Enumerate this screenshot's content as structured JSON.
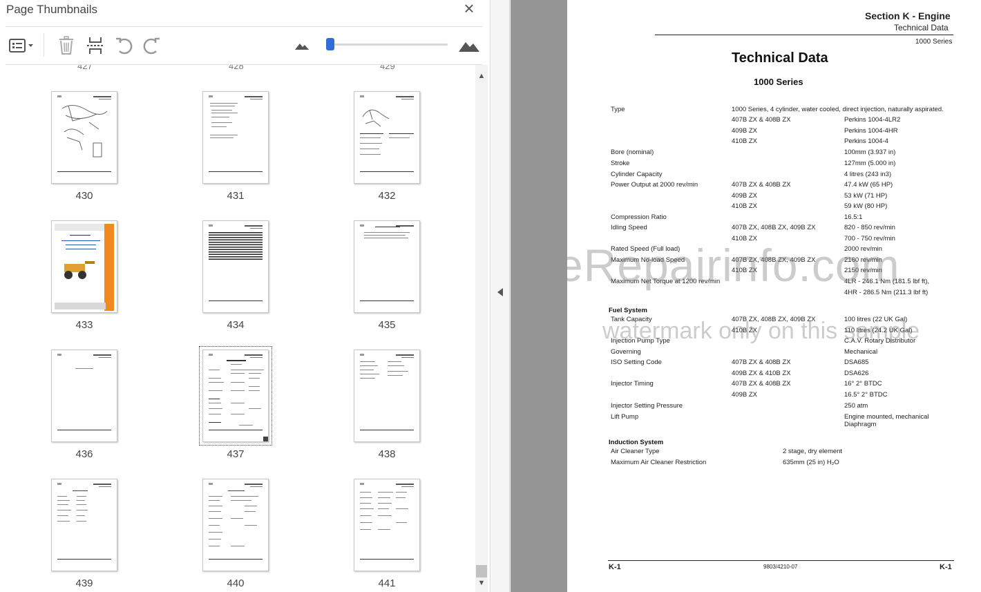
{
  "panel": {
    "title": "Page Thumbnails",
    "close_icon": "×"
  },
  "toolbar": {
    "options_icon": "options-list-icon",
    "delete_icon": "trash-icon",
    "insert_icon": "insert-pages-icon",
    "rotate_left_icon": "rotate-ccw-icon",
    "rotate_right_icon": "rotate-cw-icon",
    "zoom_out_icon": "mountain-small-icon",
    "zoom_in_icon": "mountain-large-icon",
    "zoom_level": 0.0,
    "accent": "#2d6fd6"
  },
  "thumbnails": {
    "partial_labels": [
      "427",
      "428",
      "429"
    ],
    "selected": "437",
    "pages": [
      {
        "label": "430"
      },
      {
        "label": "431"
      },
      {
        "label": "432"
      },
      {
        "label": "433"
      },
      {
        "label": "434"
      },
      {
        "label": "435"
      },
      {
        "label": "436"
      },
      {
        "label": "437"
      },
      {
        "label": "438"
      },
      {
        "label": "439"
      },
      {
        "label": "440"
      },
      {
        "label": "441"
      }
    ]
  },
  "document": {
    "header": {
      "section": "Section K - Engine",
      "subtitle": "Technical Data",
      "series": "1000 Series"
    },
    "title": "Technical Data",
    "subtitle": "1000 Series",
    "specs": [
      {
        "c": "Type",
        "m": "",
        "v": "1000 Series, 4 cylinder, water cooled, direct injection, naturally aspirated."
      },
      {
        "c": "",
        "m": "407B ZX & 408B ZX",
        "v": "Perkins 1004-4LR2"
      },
      {
        "c": "",
        "m": "409B ZX",
        "v": "Perkins 1004-4HR"
      },
      {
        "c": "",
        "m": "410B ZX",
        "v": "Perkins 1004-4"
      },
      {
        "c": "Bore (nominal)",
        "m": "",
        "v": "100mm (3.937 in)"
      },
      {
        "c": "Stroke",
        "m": "",
        "v": "127mm (5.000 in)"
      },
      {
        "c": "Cylinder Capacity",
        "m": "",
        "v": "4 litres (243 in3)"
      },
      {
        "c": "Power Output at 2000 rev/min",
        "m": "407B ZX & 408B ZX",
        "v": "47.4 kW (65 HP)"
      },
      {
        "c": "",
        "m": "409B ZX",
        "v": "53 kW (71 HP)"
      },
      {
        "c": "",
        "m": "410B ZX",
        "v": "59 kW (80 HP)"
      },
      {
        "c": "Compression Ratio",
        "m": "",
        "v": "16.5:1"
      },
      {
        "c": "Idling Speed",
        "m": "407B ZX, 408B ZX, 409B ZX",
        "v": "820 - 850 rev/min"
      },
      {
        "c": "",
        "m": "410B ZX",
        "v": "700 - 750 rev/min"
      },
      {
        "c": "Rated Speed (Full load)",
        "m": "",
        "v": "2000 rev/min"
      },
      {
        "c": "Maximum No-load Speed",
        "m": "407B ZX, 408B ZX, 409B ZX",
        "v": "2160 rev/min"
      },
      {
        "c": "",
        "m": "410B ZX",
        "v": "2150 rev/min"
      },
      {
        "c": "Maximum Net Torque at 1200 rev/min",
        "m": "",
        "v": "4LR - 246.1 Nm (181.5 lbf ft),"
      },
      {
        "c": "",
        "m": "",
        "v": "4HR - 286.5 Nm (211.3 lbf ft)"
      }
    ],
    "fuel_heading": "Fuel System",
    "fuel": [
      {
        "c": "Tank Capacity",
        "m": "407B ZX, 408B ZX, 409B ZX",
        "v": "100 litres (22 UK Gal)"
      },
      {
        "c": "",
        "m": "410B ZX",
        "v": "110 litres (24.2 UK Gal)"
      },
      {
        "c": "Injection Pump Type",
        "m": "",
        "v": "C.A.V.  Rotary Distributor"
      },
      {
        "c": "Governing",
        "m": "",
        "v": "Mechanical"
      },
      {
        "c": "ISO Setting Code",
        "m": "407B ZX & 408B ZX",
        "v": "DSA685"
      },
      {
        "c": "",
        "m": "409B ZX & 410B ZX",
        "v": "DSA626"
      },
      {
        "c": "Injector Timing",
        "m": "407B ZX & 408B ZX",
        "v": "16°  2° BTDC"
      },
      {
        "c": "",
        "m": "409B ZX",
        "v": "16.5°  2° BTDC"
      },
      {
        "c": "Injector Setting Pressure",
        "m": "",
        "v": "250 atm"
      },
      {
        "c": "Lift Pump",
        "m": "",
        "v": "Engine mounted, mechanical"
      },
      {
        "c": "",
        "m": "",
        "v": "Diaphragm"
      }
    ],
    "induction_heading": "Induction System",
    "induction": [
      {
        "c": "Air Cleaner Type",
        "v": "2 stage, dry element"
      },
      {
        "c": "Maximum Air Cleaner Restriction",
        "v": "635mm (25 in) H₂O"
      }
    ],
    "footer": {
      "left": "K-1",
      "center": "9803/4210-07",
      "right": "K-1"
    },
    "watermark_1": "eRepairinfo.com",
    "watermark_2": "watermark only on this sample"
  }
}
